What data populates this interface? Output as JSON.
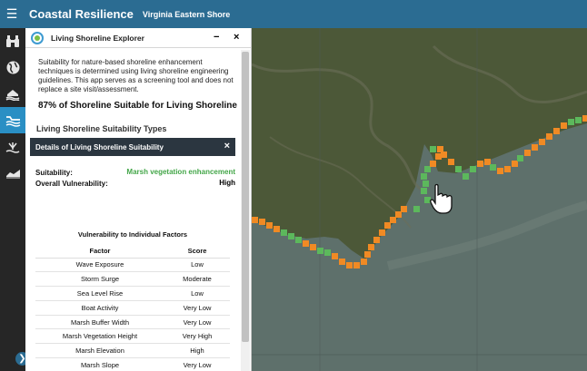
{
  "header": {
    "menu_icon": "hamburger-icon",
    "title": "Coastal Resilience",
    "subtitle": "Virginia Eastern Shore"
  },
  "rail": {
    "items": [
      {
        "icon": "binoculars-icon",
        "active": false
      },
      {
        "icon": "globe-icon",
        "active": false
      },
      {
        "icon": "house-flood-icon",
        "active": false
      },
      {
        "icon": "shoreline-icon",
        "active": true
      },
      {
        "icon": "marsh-plant-icon",
        "active": false
      },
      {
        "icon": "waves-icon",
        "active": false
      }
    ],
    "expand_icon": "chevron-right-icon"
  },
  "panel": {
    "title": "Living Shoreline Explorer",
    "minimize": "−",
    "close": "×",
    "intro": "Suitability for nature-based shoreline enhancement techniques is determined using living shoreline engineering guidelines. This app serves as a screening tool and does not replace a site visit/assessment.",
    "headline": "87% of Shoreline Suitable for Living Shoreline",
    "section_title": "Living Shoreline Suitability Types",
    "details": {
      "title": "Details of Living Shoreline Suitability",
      "close": "×",
      "suitability_label": "Suitability:",
      "suitability_value": "Marsh vegetation enhancement",
      "vulnerability_label": "Overall Vulnerability:",
      "vulnerability_value": "High",
      "table_title": "Vulnerability to Individual Factors",
      "columns": [
        "Factor",
        "Score"
      ],
      "rows": [
        [
          "Wave Exposure",
          "Low"
        ],
        [
          "Storm Surge",
          "Moderate"
        ],
        [
          "Sea Level Rise",
          "Low"
        ],
        [
          "Boat Activity",
          "Very Low"
        ],
        [
          "Marsh Buffer Width",
          "Very Low"
        ],
        [
          "Marsh Vegetation Height",
          "Very High"
        ],
        [
          "Marsh Elevation",
          "High"
        ],
        [
          "Marsh Slope",
          "Very Low"
        ]
      ]
    }
  },
  "colors": {
    "header": "#2b6c92",
    "rail": "#262626",
    "rail_active": "#2a8fc4",
    "suitable_green": "#5cb85c",
    "segment_orange": "#f08a24",
    "water": "#5d6f6a",
    "land": "#4a5533"
  },
  "map": {
    "cursor_icon": "hand-pointer-icon"
  }
}
